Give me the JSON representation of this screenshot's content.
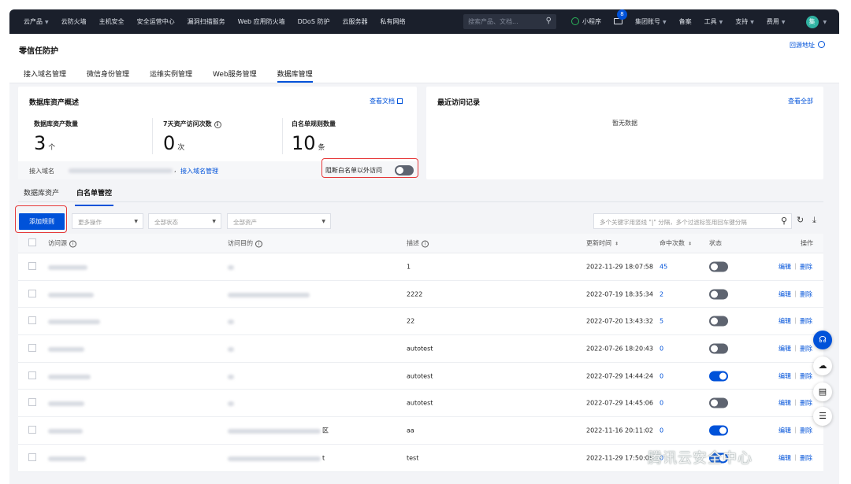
{
  "topbar": {
    "nav": [
      "云产品",
      "云防火墙",
      "主机安全",
      "安全运营中心",
      "漏洞扫描服务",
      "Web 应用防火墙",
      "DDoS 防护",
      "云服务器",
      "私有网络"
    ],
    "search_placeholder": "搜索产品、文档...",
    "miniprogram": "小程序",
    "mail_badge": "8",
    "group_account": "集团账号",
    "filing": "备案",
    "tools": "工具",
    "support": "支持",
    "billing": "费用",
    "avatar_char": "集"
  },
  "header": {
    "title": "零信任防护",
    "origin_link": "回源地址",
    "tabs": [
      "接入域名管理",
      "微信身份管理",
      "运维实例管理",
      "Web服务管理",
      "数据库管理"
    ],
    "active_tab": 4
  },
  "overview": {
    "title": "数据库资产概述",
    "doc_link": "查看文档",
    "stats": [
      {
        "label": "数据库资产数量",
        "value": "3",
        "unit": "个"
      },
      {
        "label": "7天资产访问次数",
        "value": "0",
        "unit": "次"
      },
      {
        "label": "白名单规则数量",
        "value": "10",
        "unit": "条"
      }
    ],
    "domain_label": "接入域名",
    "domain_sep": ",",
    "domain_manage_link": "接入域名管理",
    "block_label": "阻断白名单以外访问",
    "block_on": false
  },
  "recent": {
    "title": "最近访问记录",
    "view_all": "查看全部",
    "empty": "暂无数据"
  },
  "subtabs": [
    "数据库资产",
    "白名单管控"
  ],
  "active_subtab": 1,
  "toolbar": {
    "add_rule": "添加规则",
    "more_ops": "更多操作",
    "all_status": "全部状态",
    "all_assets": "全部资产",
    "filter_placeholder": "多个关键字用竖线 \"|\" 分隔，多个过滤标签用回车键分隔"
  },
  "table": {
    "columns": {
      "source": "访问源",
      "target": "访问目的",
      "desc": "描述",
      "updated": "更新时间",
      "hits": "命中次数",
      "status": "状态",
      "ops": "操作"
    },
    "edit": "编辑",
    "delete": "删除",
    "rows": [
      {
        "target_suffix": "",
        "desc": "1",
        "updated": "2022-11-29 18:07:58",
        "hits": "45",
        "on": false
      },
      {
        "target_suffix": "",
        "desc": "2222",
        "updated": "2022-07-19 18:35:34",
        "hits": "2",
        "on": false
      },
      {
        "target_suffix": "",
        "desc": "22",
        "updated": "2022-07-20 13:43:32",
        "hits": "5",
        "on": false
      },
      {
        "target_suffix": "",
        "desc": "autotest",
        "updated": "2022-07-26 18:20:43",
        "hits": "0",
        "on": false
      },
      {
        "target_suffix": "",
        "desc": "autotest",
        "updated": "2022-07-29 14:44:24",
        "hits": "0",
        "on": true
      },
      {
        "target_suffix": "",
        "desc": "autotest",
        "updated": "2022-07-29 14:45:06",
        "hits": "0",
        "on": false
      },
      {
        "target_suffix": "区",
        "desc": "aa",
        "updated": "2022-11-16 20:11:02",
        "hits": "0",
        "on": true
      },
      {
        "target_suffix": "t",
        "desc": "test",
        "updated": "2022-11-29 17:50:08",
        "hits": "0",
        "on": true
      }
    ]
  },
  "watermark": "腾讯云安全中心",
  "colors": {
    "primary": "#0052d9",
    "topbar": "#1a1f2b",
    "highlight": "#e6393a"
  }
}
